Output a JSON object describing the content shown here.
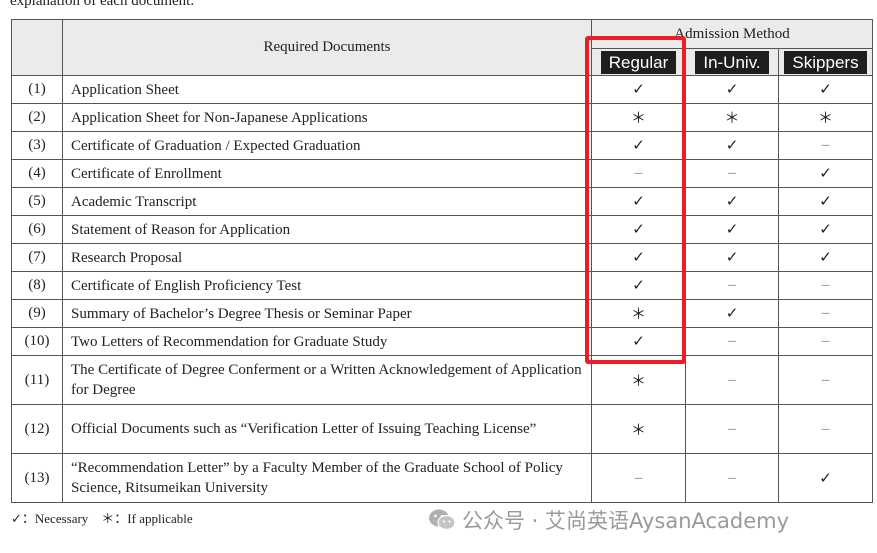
{
  "intro_text": "explanation of each document.",
  "table": {
    "header_required": "Required Documents",
    "header_method": "Admission Method",
    "methods": [
      "Regular",
      "In-Univ.",
      "Skippers"
    ],
    "rows": [
      {
        "num": "(1)",
        "doc": "Application Sheet",
        "marks": [
          "✓",
          "✓",
          "✓"
        ]
      },
      {
        "num": "(2)",
        "doc": "Application Sheet for Non-Japanese Applications",
        "marks": [
          "＊",
          "＊",
          "＊"
        ]
      },
      {
        "num": "(3)",
        "doc": "Certificate of Graduation / Expected Graduation",
        "marks": [
          "✓",
          "✓",
          "–"
        ]
      },
      {
        "num": "(4)",
        "doc": "Certificate of Enrollment",
        "marks": [
          "–",
          "–",
          "✓"
        ]
      },
      {
        "num": "(5)",
        "doc": "Academic Transcript",
        "marks": [
          "✓",
          "✓",
          "✓"
        ]
      },
      {
        "num": "(6)",
        "doc": "Statement of Reason for Application",
        "marks": [
          "✓",
          "✓",
          "✓"
        ]
      },
      {
        "num": "(7)",
        "doc": "Research Proposal",
        "marks": [
          "✓",
          "✓",
          "✓"
        ]
      },
      {
        "num": "(8)",
        "doc": "Certificate of English Proficiency Test",
        "marks": [
          "✓",
          "–",
          "–"
        ]
      },
      {
        "num": "(9)",
        "doc": "Summary of Bachelor’s Degree Thesis or Seminar Paper",
        "marks": [
          "＊",
          "✓",
          "–"
        ]
      },
      {
        "num": "(10)",
        "doc": "Two Letters of Recommendation for Graduate Study",
        "marks": [
          "✓",
          "–",
          "–"
        ]
      },
      {
        "num": "(11)",
        "doc": "The Certificate of Degree Conferment or a Written Acknowledgement of Application for Degree",
        "marks": [
          "＊",
          "–",
          "–"
        ]
      },
      {
        "num": "(12)",
        "doc": "Official Documents such as “Verification Letter of Issuing Teaching License”",
        "marks": [
          "＊",
          "–",
          "–"
        ]
      },
      {
        "num": "(13)",
        "doc": "“Recommendation Letter” by a Faculty Member of the Graduate School of Policy Science, Ritsumeikan University",
        "marks": [
          "–",
          "–",
          "✓"
        ]
      }
    ]
  },
  "legend": "✓：Necessary　＊：If applicable",
  "watermark": "公众号 · 艾尚英语AysanAcademy",
  "colors": {
    "highlight": "#ee1c25",
    "badge_bg": "#1e1e1e",
    "header_bg": "#ebebeb"
  }
}
